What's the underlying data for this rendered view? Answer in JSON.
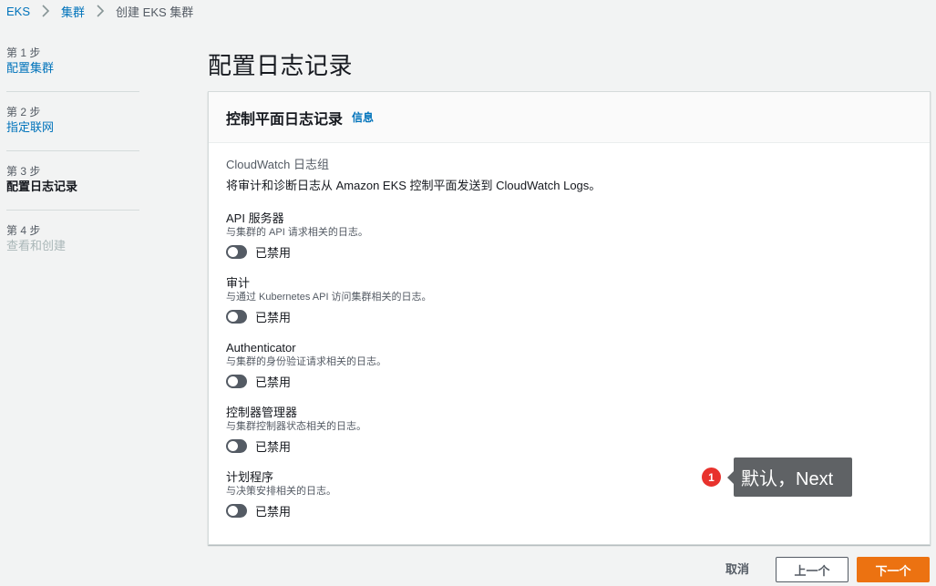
{
  "breadcrumb": {
    "items": [
      "EKS",
      "集群",
      "创建 EKS 集群"
    ]
  },
  "steps": [
    {
      "num": "第 1 步",
      "title": "配置集群"
    },
    {
      "num": "第 2 步",
      "title": "指定联网"
    },
    {
      "num": "第 3 步",
      "title": "配置日志记录"
    },
    {
      "num": "第 4 步",
      "title": "查看和创建"
    }
  ],
  "page": {
    "title": "配置日志记录"
  },
  "panel": {
    "title": "控制平面日志记录",
    "info_link": "信息",
    "group_label": "CloudWatch 日志组",
    "group_desc": "将审计和诊断日志从 Amazon EKS 控制平面发送到 CloudWatch Logs。",
    "logs": [
      {
        "name": "API 服务器",
        "desc": "与集群的 API 请求相关的日志。",
        "status": "已禁用"
      },
      {
        "name": "审计",
        "desc": "与通过 Kubernetes API 访问集群相关的日志。",
        "status": "已禁用"
      },
      {
        "name": "Authenticator",
        "desc": "与集群的身份验证请求相关的日志。",
        "status": "已禁用"
      },
      {
        "name": "控制器管理器",
        "desc": "与集群控制器状态相关的日志。",
        "status": "已禁用"
      },
      {
        "name": "计划程序",
        "desc": "与决策安排相关的日志。",
        "status": "已禁用"
      }
    ]
  },
  "footer": {
    "cancel": "取消",
    "prev": "上一个",
    "next": "下一个"
  },
  "annotation": {
    "badge": "1",
    "text": "默认，Next"
  },
  "colors": {
    "link": "#0073bb",
    "primary_button": "#ec7211",
    "toggle_off": "#545b64",
    "annotation_badge": "#e8322d"
  }
}
